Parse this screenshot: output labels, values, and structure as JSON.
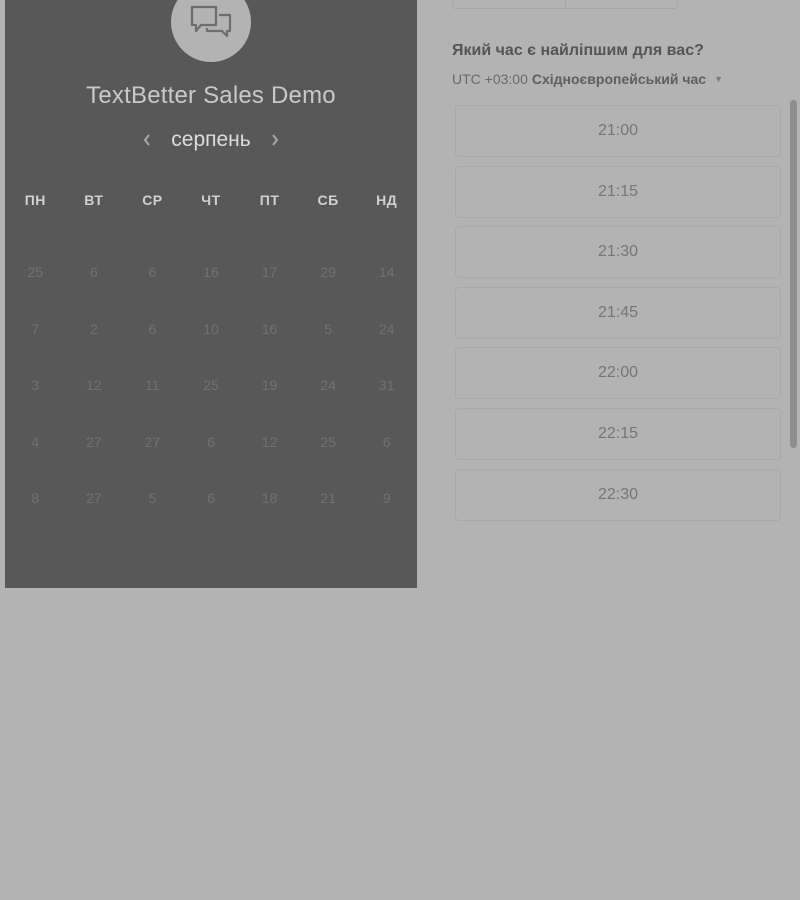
{
  "calendar": {
    "title": "TextBetter Sales Demo",
    "month": "серпень",
    "prev_icon": "chevron-left-icon",
    "next_icon": "chevron-right-icon",
    "weekdays": [
      "ПН",
      "ВТ",
      "СР",
      "ЧТ",
      "ПТ",
      "СБ",
      "НД"
    ],
    "days": [
      [
        "25",
        "6",
        "6",
        "16",
        "17",
        "29",
        "14"
      ],
      [
        "7",
        "2",
        "6",
        "10",
        "16",
        "5",
        "24"
      ],
      [
        "3",
        "12",
        "11",
        "25",
        "19",
        "24",
        "31"
      ],
      [
        "4",
        "27",
        "27",
        "6",
        "12",
        "25",
        "6"
      ],
      [
        "8",
        "27",
        "5",
        "6",
        "18",
        "21",
        "9"
      ]
    ]
  },
  "schedule": {
    "question": "Який час є найліпшим для вас?",
    "timezone_offset": "UTC +03:00",
    "timezone_name": "Східноєвропейський час",
    "slots": [
      "21:00",
      "21:15",
      "21:30",
      "21:45",
      "22:00",
      "22:15",
      "22:30"
    ]
  },
  "colors": {
    "background": "#b3b3b3",
    "panel": "#585858"
  }
}
